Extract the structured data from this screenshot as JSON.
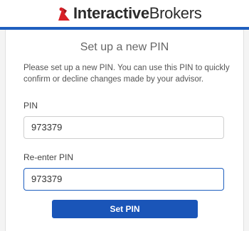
{
  "brand": {
    "name_bold": "Interactive",
    "name_light": "Brokers",
    "logo_icon": "ib-logo-mark",
    "accent_color": "#1f5fbf",
    "logo_color": "#d81f26"
  },
  "form": {
    "title": "Set up a new PIN",
    "description": "Please set up a new PIN. You can use this PIN to quickly confirm or decline changes made by your advisor.",
    "pin_label": "PIN",
    "pin_value": "973379",
    "repin_label": "Re-enter PIN",
    "repin_value": "973379",
    "submit_label": "Set PIN"
  }
}
